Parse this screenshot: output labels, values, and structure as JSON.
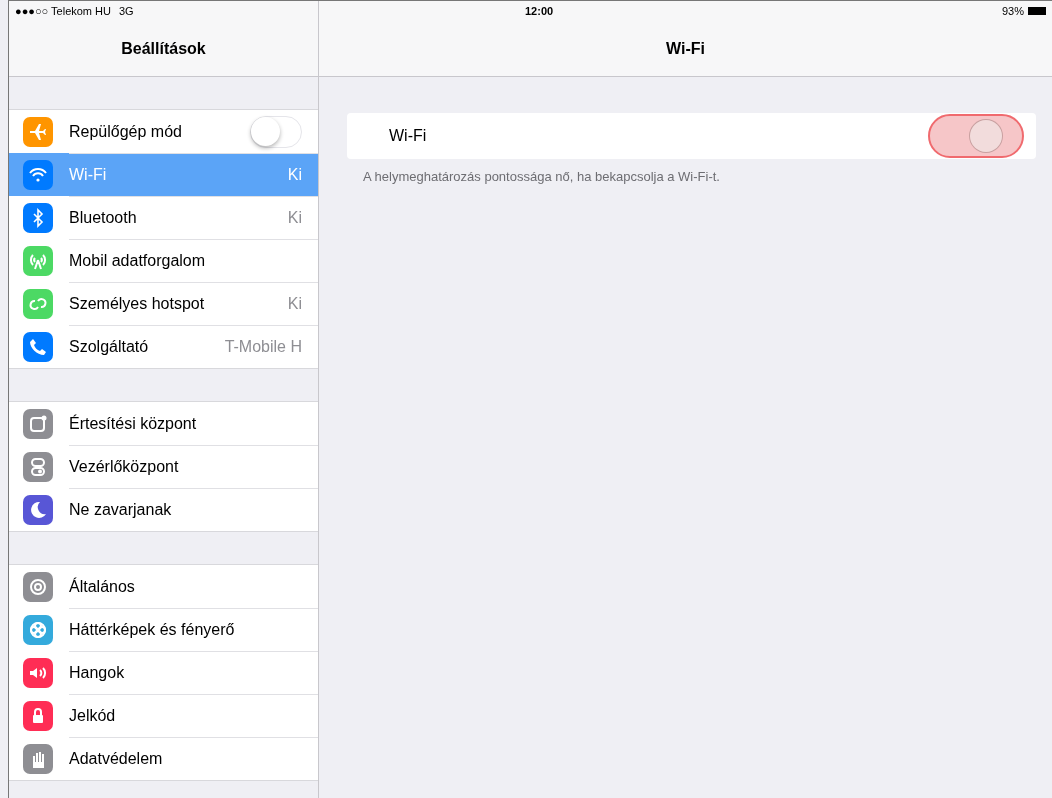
{
  "status_bar": {
    "carrier": "●●●○○ Telekom HU",
    "network": "3G",
    "time": "12:00",
    "battery": "93%"
  },
  "sidebar": {
    "title": "Beállítások",
    "sections": [
      [
        {
          "kind": "toggle",
          "label": "Repülőgép mód",
          "on": false,
          "selected": false,
          "color": "#ff9500"
        },
        {
          "kind": "detail",
          "label": "Wi-Fi",
          "value": "Ki",
          "selected": true,
          "color": "#007aff"
        },
        {
          "kind": "detail",
          "label": "Bluetooth",
          "value": "Ki",
          "selected": false,
          "color": "#007aff"
        },
        {
          "kind": "detail",
          "label": "Mobil adatforgalom",
          "selected": false,
          "color": "#4cd964"
        },
        {
          "kind": "detail",
          "label": "Személyes hotspot",
          "value": "Ki",
          "selected": false,
          "color": "#4cd964"
        },
        {
          "kind": "detail",
          "label": "Szolgáltató",
          "value": "T-Mobile H",
          "selected": false,
          "color": "#007aff"
        }
      ],
      [
        {
          "kind": "detail",
          "label": "Értesítési központ",
          "selected": false,
          "color": "#8e8e93"
        },
        {
          "kind": "detail",
          "label": "Vezérlőközpont",
          "selected": false,
          "color": "#8e8e93"
        },
        {
          "kind": "detail",
          "label": "Ne zavarjanak",
          "selected": false,
          "color": "#5856d6"
        }
      ],
      [
        {
          "kind": "detail",
          "label": "Általános",
          "selected": false,
          "color": "#8e8e93"
        },
        {
          "kind": "detail",
          "label": "Háttérképek és fényerő",
          "selected": false,
          "color": "#34aadc"
        },
        {
          "kind": "detail",
          "label": "Hangok",
          "selected": false,
          "color": "#ff2d55"
        },
        {
          "kind": "detail",
          "label": "Jelkód",
          "selected": false,
          "color": "#ff2d55"
        },
        {
          "kind": "detail",
          "label": "Adatvédelem",
          "selected": false,
          "color": "#8e8e93"
        }
      ]
    ]
  },
  "detail": {
    "title": "Wi-Fi",
    "setting": {
      "label": "Wi-Fi",
      "on": false,
      "highlighted": true
    },
    "footer": "A helymeghatározás pontossága nő, ha bekapcsolja a Wi-Fi-t."
  }
}
